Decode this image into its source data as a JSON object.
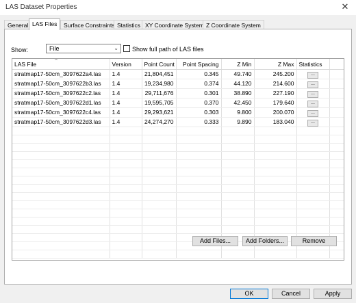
{
  "window": {
    "title": "LAS Dataset Properties",
    "close_glyph": "✕"
  },
  "tabs": [
    {
      "label": "General"
    },
    {
      "label": "LAS Files",
      "active": true
    },
    {
      "label": "Surface Constraints"
    },
    {
      "label": "Statistics"
    },
    {
      "label": "XY Coordinate System"
    },
    {
      "label": "Z Coordinate System"
    }
  ],
  "show": {
    "label": "Show:",
    "selected": "File",
    "checkbox_label": "Show full path of LAS files",
    "checkbox_checked": false
  },
  "table": {
    "sort_glyph": "^",
    "columns": [
      "LAS File",
      "Version",
      "Point Count",
      "Point Spacing",
      "Z Min",
      "Z Max",
      "Statistics"
    ],
    "rows": [
      [
        "stratmap17-50cm_3097622a4.las",
        "1.4",
        "21,804,451",
        "0.345",
        "49.740",
        "245.200",
        "..."
      ],
      [
        "stratmap17-50cm_3097622b3.las",
        "1.4",
        "19,234,980",
        "0.374",
        "44.120",
        "214.600",
        "..."
      ],
      [
        "stratmap17-50cm_3097622c2.las",
        "1.4",
        "29,711,676",
        "0.301",
        "38.890",
        "227.190",
        "..."
      ],
      [
        "stratmap17-50cm_3097622d1.las",
        "1.4",
        "19,595,705",
        "0.370",
        "42.450",
        "179.640",
        "..."
      ],
      [
        "stratmap17-50cm_3097622c4.las",
        "1.4",
        "29,293,621",
        "0.303",
        "9.800",
        "200.070",
        "..."
      ],
      [
        "stratmap17-50cm_3097622d3.las",
        "1.4",
        "24,274,270",
        "0.333",
        "9.890",
        "183.040",
        "..."
      ]
    ]
  },
  "actions": {
    "add_files": "Add Files...",
    "add_folders": "Add Folders...",
    "remove": "Remove"
  },
  "footer": {
    "ok": "OK",
    "cancel": "Cancel",
    "apply": "Apply"
  }
}
